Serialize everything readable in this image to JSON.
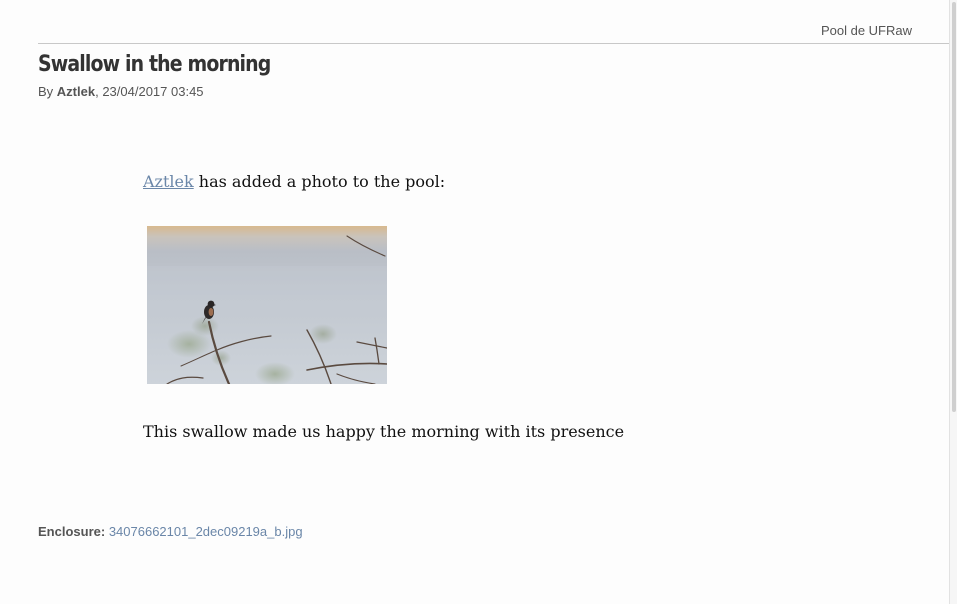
{
  "header": {
    "feed_source": "Pool de UFRaw"
  },
  "article": {
    "title": "Swallow in the morning",
    "byline_prefix": "By ",
    "author": "Aztlek",
    "date_sep": ", ",
    "date": "23/04/2017 03:45"
  },
  "content": {
    "intro_link": "Aztlek",
    "intro_text": " has added a photo to the pool:",
    "photo_alt": "Swallow perched on a bare branch",
    "description": "This swallow made us happy the morning with its presence"
  },
  "enclosure": {
    "label": "Enclosure:",
    "filename": "34076662101_2dec09219a_b.jpg"
  },
  "colors": {
    "link": "#6a86a8",
    "text": "#111111",
    "meta": "#555555"
  }
}
